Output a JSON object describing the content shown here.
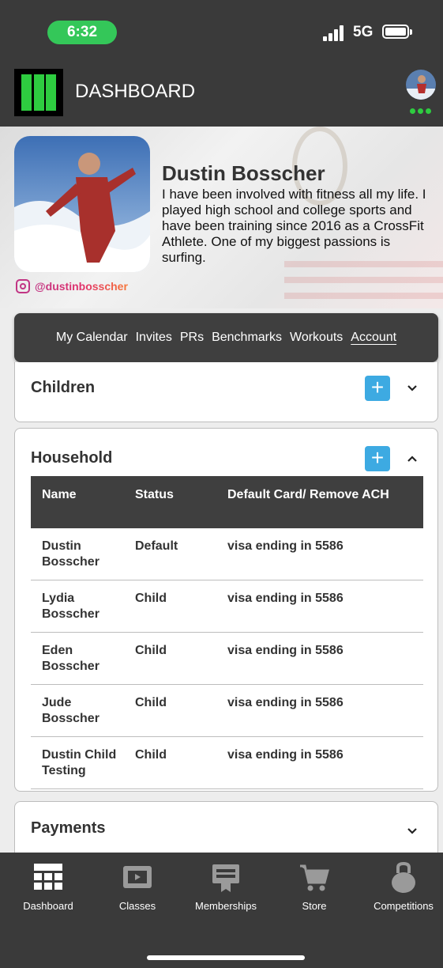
{
  "status_bar": {
    "time": "6:32",
    "network": "5G"
  },
  "header": {
    "title": "DASHBOARD"
  },
  "profile": {
    "name": "Dustin Bosscher",
    "bio": "I have been involved with fitness all my life. I played high school and college sports and have been training since 2016 as a CrossFit Athlete. One of my biggest passions is surfing.",
    "instagram": "@dustinbosscher"
  },
  "nav": {
    "items": [
      "My Calendar",
      "Invites",
      "PRs",
      "Benchmarks",
      "Workouts",
      "Account"
    ],
    "active": "Account"
  },
  "children": {
    "title": "Children",
    "add_label": "+"
  },
  "household": {
    "title": "Household",
    "add_label": "+",
    "columns": [
      "Name",
      "Status",
      "Default Card/ Remove ACH"
    ],
    "rows": [
      [
        "Dustin Bosscher",
        "Default",
        "visa ending in 5586"
      ],
      [
        "Lydia Bosscher",
        "Child",
        "visa ending in 5586"
      ],
      [
        "Eden Bosscher",
        "Child",
        "visa ending in 5586"
      ],
      [
        "Jude Bosscher",
        "Child",
        "visa ending in 5586"
      ],
      [
        "Dustin Child Testing",
        "Child",
        "visa ending in 5586"
      ]
    ]
  },
  "payments": {
    "title": "Payments"
  },
  "tabbar": {
    "items": [
      {
        "label": "Dashboard",
        "icon": "grid-icon"
      },
      {
        "label": "Classes",
        "icon": "video-icon"
      },
      {
        "label": "Memberships",
        "icon": "membership-card-icon"
      },
      {
        "label": "Store",
        "icon": "cart-icon"
      },
      {
        "label": "Competitions",
        "icon": "kettlebell-icon"
      }
    ]
  },
  "colors": {
    "header_bg": "#3a3a3a",
    "accent_green": "#2ecc40",
    "add_button_blue": "#3daae2",
    "time_pill_green": "#34c759",
    "instagram_pink": "#c13584"
  }
}
